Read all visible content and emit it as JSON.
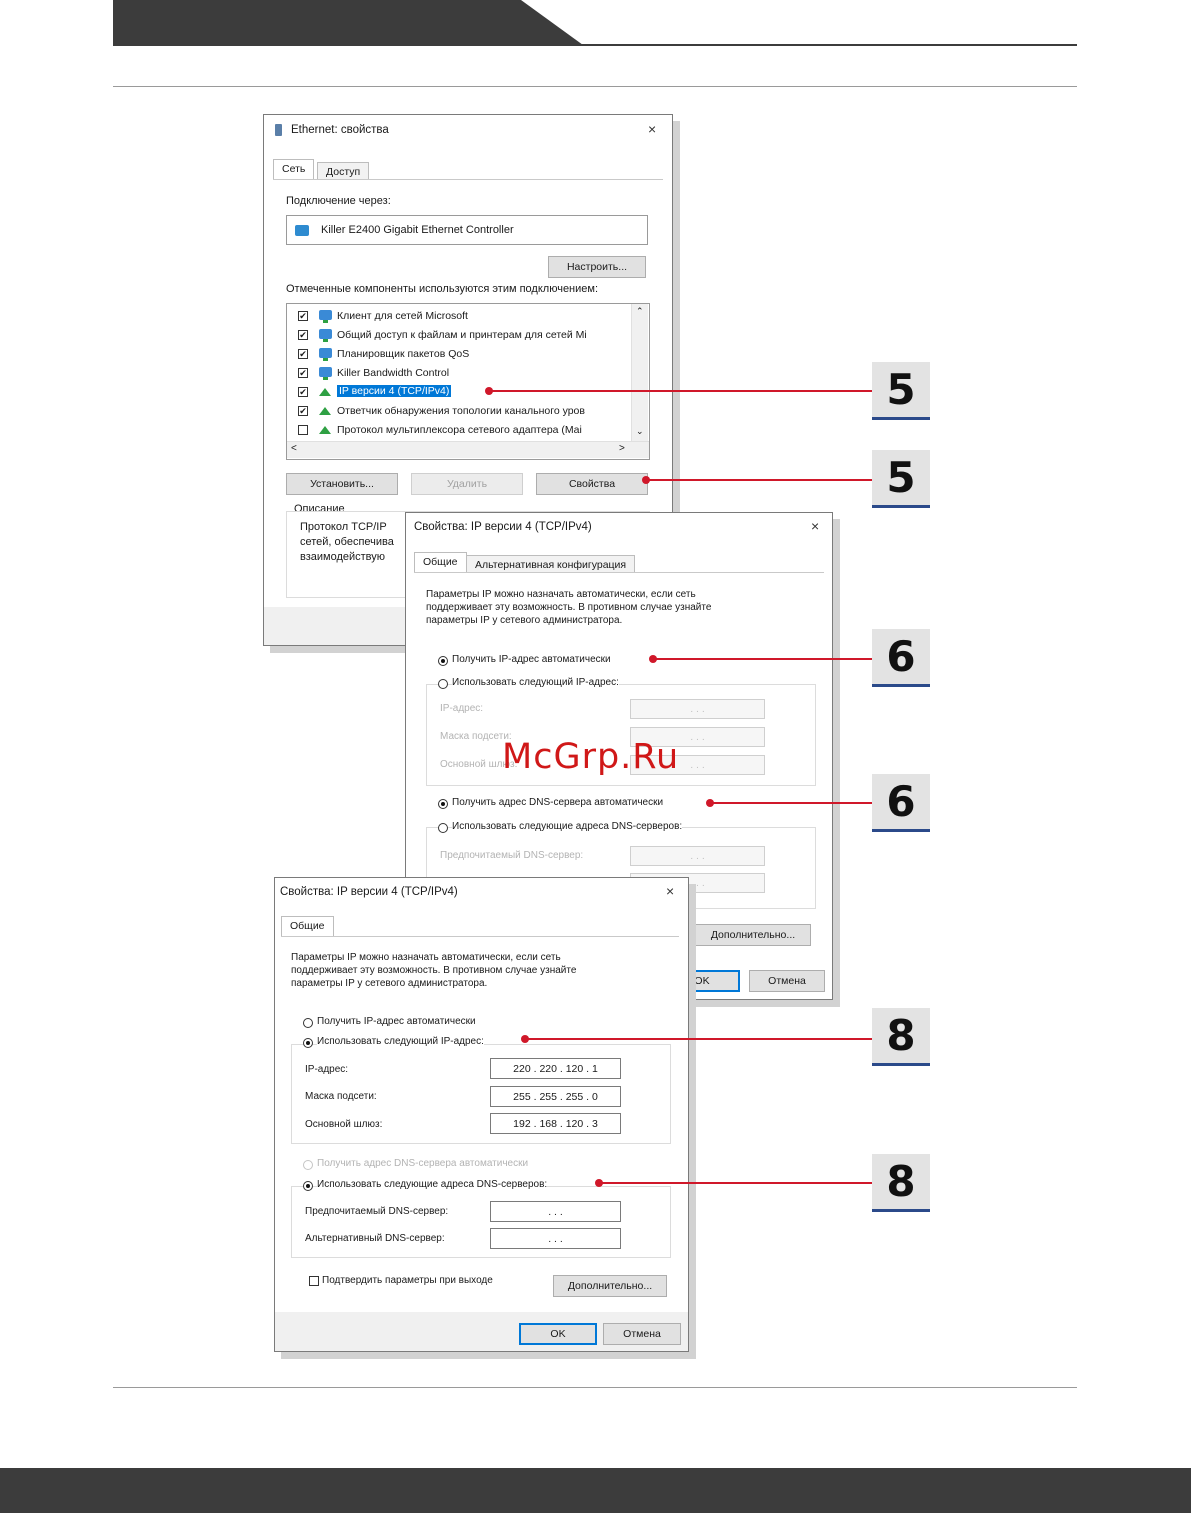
{
  "dialog1": {
    "title": "Ethernet: свойства",
    "close": "×",
    "tabs": [
      "Сеть",
      "Доступ"
    ],
    "connect_via_label": "Подключение через:",
    "adapter": "Killer E2400 Gigabit Ethernet Controller",
    "configure_button": "Настроить...",
    "components_label": "Отмеченные компоненты используются этим подключением:",
    "components": [
      {
        "label": "Клиент для сетей Microsoft",
        "checked": "✔"
      },
      {
        "label": "Общий доступ к файлам и принтерам для сетей Mi",
        "checked": "✔"
      },
      {
        "label": "Планировщик пакетов QoS",
        "checked": "✔"
      },
      {
        "label": "Killer Bandwidth Control",
        "checked": "✔"
      },
      {
        "label": "IP версии 4 (TCP/IPv4)",
        "checked": "✔"
      },
      {
        "label": "Ответчик обнаружения топологии канального уров",
        "checked": "✔"
      },
      {
        "label": "Протокол мультиплексора сетевого адаптера (Mai",
        "checked": ""
      }
    ],
    "install_button": "Установить...",
    "remove_button": "Удалить",
    "properties_button": "Свойства",
    "description_label": "Описание",
    "description_lines": [
      "Протокол TCP/IP",
      "сетей, обеспечива",
      "взаимодействую"
    ]
  },
  "dialog2": {
    "title": "Свойства: IP версии 4 (TCP/IPv4)",
    "close": "×",
    "tabs": [
      "Общие",
      "Альтернативная конфигурация"
    ],
    "intro": [
      "Параметры IP можно назначать автоматически, если сеть",
      "поддерживает эту возможность. В противном случае узнайте",
      "параметры IP у сетевого администратора."
    ],
    "auto_ip": "Получить IP-адрес автоматически",
    "manual_ip": "Использовать следующий IP-адрес:",
    "ip_label": "IP-адрес:",
    "mask_label": "Маска подсети:",
    "gateway_label": "Основной шлюз:",
    "auto_dns": "Получить адрес DNS-сервера автоматически",
    "manual_dns": "Использовать следующие адреса DNS-серверов:",
    "preferred_dns_label": "Предпочитаемый DNS-сервер:",
    "empty_ip": ".     .     .",
    "advanced_button": "Дополнительно...",
    "ok_button": "OK",
    "cancel_button": "Отмена"
  },
  "dialog3": {
    "title": "Свойства: IP версии 4 (TCP/IPv4)",
    "close": "×",
    "tabs": [
      "Общие"
    ],
    "intro": [
      "Параметры IP можно назначать автоматически, если сеть",
      "поддерживает эту возможность. В противном случае узнайте",
      "параметры IP у сетевого администратора."
    ],
    "auto_ip": "Получить IP-адрес автоматически",
    "manual_ip": "Использовать следующий IP-адрес:",
    "ip_label": "IP-адрес:",
    "ip_value": "220 . 220 . 120 .  1",
    "mask_label": "Маска подсети:",
    "mask_value": "255 . 255 . 255 .  0",
    "gateway_label": "Основной шлюз:",
    "gateway_value": "192 . 168 . 120 .  3",
    "auto_dns": "Получить адрес DNS-сервера автоматически",
    "manual_dns": "Использовать следующие адреса DNS-серверов:",
    "preferred_dns_label": "Предпочитаемый DNS-сервер:",
    "alternate_dns_label": "Альтернативный DNS-сервер:",
    "empty_ip": ".     .     .",
    "validate_label": "Подтвердить параметры при выходе",
    "advanced_button": "Дополнительно...",
    "ok_button": "OK",
    "cancel_button": "Отмена"
  },
  "callouts": [
    "5",
    "5",
    "6",
    "6",
    "8",
    "8"
  ],
  "watermark": "McGrp.Ru",
  "colors": {
    "accent": "#d0182a",
    "header": "#3c3c3c",
    "selection": "#0078d7"
  }
}
